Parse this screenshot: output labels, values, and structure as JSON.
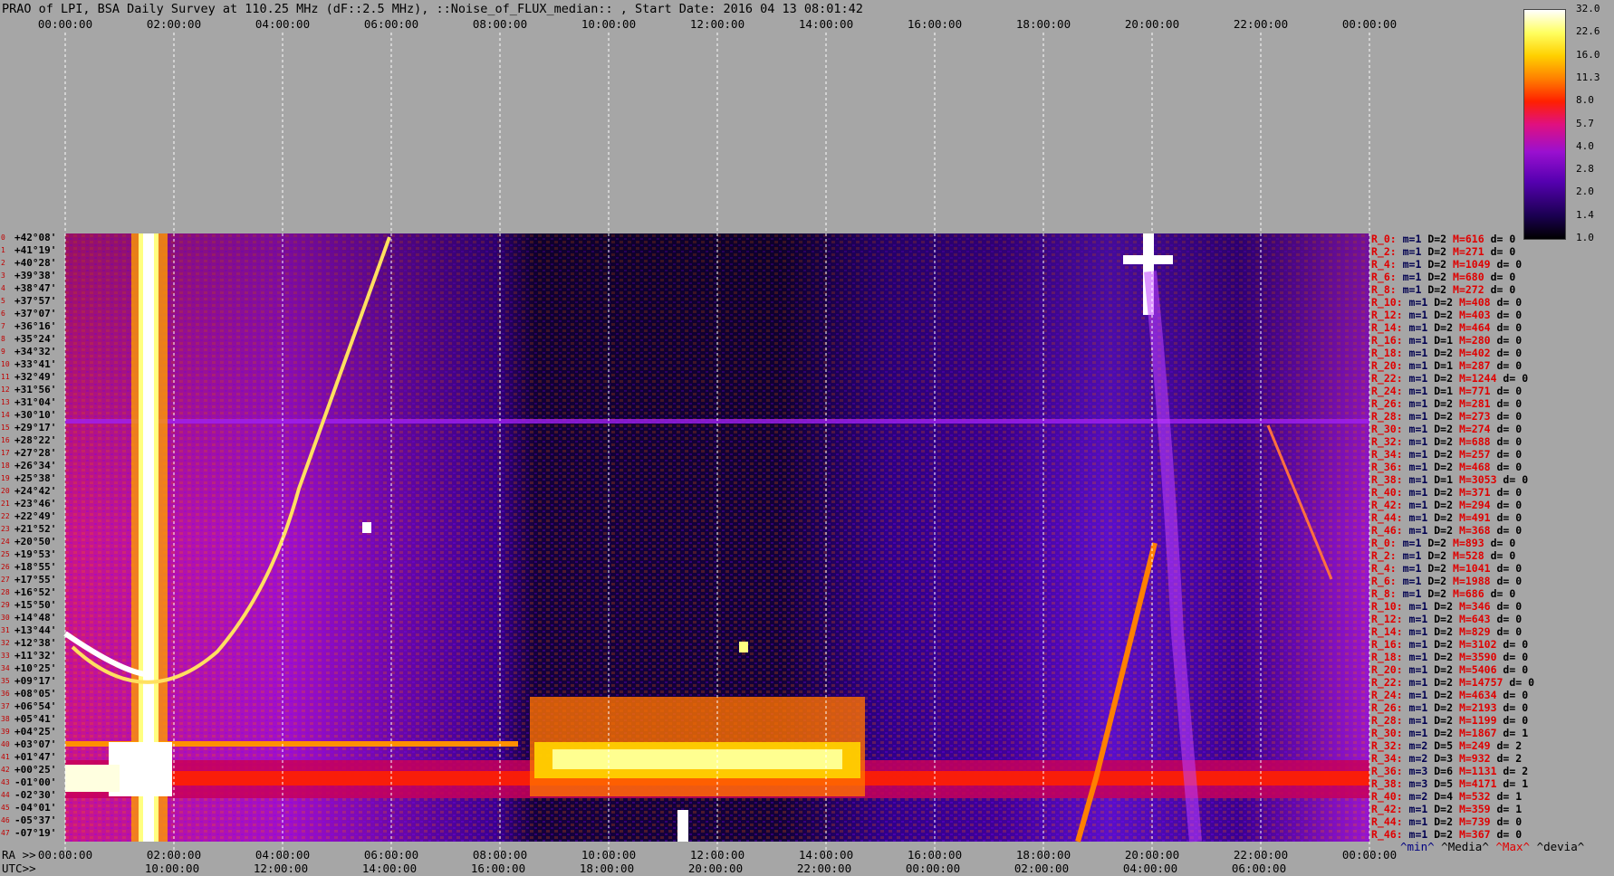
{
  "title": "PRAO of LPI, BSA Daily Survey at 110.25 MHz (dF::2.5 MHz), ::Noise_of_FLUX_median:: , Start Date: 2016 04 13 08:01:42",
  "top_axis_ticks": [
    "00:00:00",
    "02:00:00",
    "04:00:00",
    "06:00:00",
    "08:00:00",
    "10:00:00",
    "12:00:00",
    "14:00:00",
    "16:00:00",
    "18:00:00",
    "20:00:00",
    "22:00:00",
    "00:00:00"
  ],
  "ra_label": "RA >>",
  "utc_label": "UTC>>",
  "bottom_ra_ticks": [
    "00:00:00",
    "02:00:00",
    "04:00:00",
    "06:00:00",
    "08:00:00",
    "10:00:00",
    "12:00:00",
    "14:00:00",
    "16:00:00",
    "18:00:00",
    "20:00:00",
    "22:00:00",
    "00:00:00"
  ],
  "bottom_utc_ticks": [
    "10:00:00",
    "12:00:00",
    "14:00:00",
    "16:00:00",
    "18:00:00",
    "20:00:00",
    "22:00:00",
    "00:00:00",
    "02:00:00",
    "04:00:00",
    "06:00:00"
  ],
  "colorbar_ticks": [
    "32.0",
    "22.6",
    "16.0",
    "11.3",
    "8.0",
    "5.7",
    "4.0",
    "2.8",
    "2.0",
    "1.4",
    "1.0"
  ],
  "declinations": [
    "+42°08'",
    "+41°19'",
    "+40°28'",
    "+39°38'",
    "+38°47'",
    "+37°57'",
    "+37°07'",
    "+36°16'",
    "+35°24'",
    "+34°32'",
    "+33°41'",
    "+32°49'",
    "+31°56'",
    "+31°04'",
    "+30°10'",
    "+29°17'",
    "+28°22'",
    "+27°28'",
    "+26°34'",
    "+25°38'",
    "+24°42'",
    "+23°46'",
    "+22°49'",
    "+21°52'",
    "+20°50'",
    "+19°53'",
    "+18°55'",
    "+17°55'",
    "+16°52'",
    "+15°50'",
    "+14°48'",
    "+13°44'",
    "+12°38'",
    "+11°32'",
    "+10°25'",
    "+09°17'",
    "+08°05'",
    "+06°54'",
    "+05°41'",
    "+04°25'",
    "+03°07'",
    "+01°47'",
    "+00°25'",
    "-01°00'",
    "-02°30'",
    "-04°01'",
    "-05°37'",
    "-07°19'"
  ],
  "row_indices": [
    "0",
    "1",
    "2",
    "3",
    "4",
    "5",
    "6",
    "7",
    "8",
    "9",
    "10",
    "11",
    "12",
    "13",
    "14",
    "15",
    "16",
    "17",
    "18",
    "19",
    "20",
    "21",
    "22",
    "23",
    "24",
    "25",
    "26",
    "27",
    "28",
    "29",
    "30",
    "31",
    "32",
    "33",
    "34",
    "35",
    "36",
    "37",
    "38",
    "39",
    "40",
    "41",
    "42",
    "43",
    "44",
    "45",
    "46",
    "47"
  ],
  "right_rows": [
    {
      "r": "R_0:",
      "m": "m=1",
      "d": "D=2",
      "M": "M=616",
      "dv": "d= 0"
    },
    {
      "r": "R_2:",
      "m": "m=1",
      "d": "D=2",
      "M": "M=271",
      "dv": "d= 0"
    },
    {
      "r": "R_4:",
      "m": "m=1",
      "d": "D=2",
      "M": "M=1049",
      "dv": "d= 0"
    },
    {
      "r": "R_6:",
      "m": "m=1",
      "d": "D=2",
      "M": "M=680",
      "dv": "d= 0"
    },
    {
      "r": "R_8:",
      "m": "m=1",
      "d": "D=2",
      "M": "M=272",
      "dv": "d= 0"
    },
    {
      "r": "R_10:",
      "m": "m=1",
      "d": "D=2",
      "M": "M=408",
      "dv": "d= 0"
    },
    {
      "r": "R_12:",
      "m": "m=1",
      "d": "D=2",
      "M": "M=403",
      "dv": "d= 0"
    },
    {
      "r": "R_14:",
      "m": "m=1",
      "d": "D=2",
      "M": "M=464",
      "dv": "d= 0"
    },
    {
      "r": "R_16:",
      "m": "m=1",
      "d": "D=1",
      "M": "M=280",
      "dv": "d= 0"
    },
    {
      "r": "R_18:",
      "m": "m=1",
      "d": "D=2",
      "M": "M=402",
      "dv": "d= 0"
    },
    {
      "r": "R_20:",
      "m": "m=1",
      "d": "D=1",
      "M": "M=287",
      "dv": "d= 0"
    },
    {
      "r": "R_22:",
      "m": "m=1",
      "d": "D=2",
      "M": "M=1244",
      "dv": "d= 0"
    },
    {
      "r": "R_24:",
      "m": "m=1",
      "d": "D=1",
      "M": "M=771",
      "dv": "d= 0"
    },
    {
      "r": "R_26:",
      "m": "m=1",
      "d": "D=2",
      "M": "M=281",
      "dv": "d= 0"
    },
    {
      "r": "R_28:",
      "m": "m=1",
      "d": "D=2",
      "M": "M=273",
      "dv": "d= 0"
    },
    {
      "r": "R_30:",
      "m": "m=1",
      "d": "D=2",
      "M": "M=274",
      "dv": "d= 0"
    },
    {
      "r": "R_32:",
      "m": "m=1",
      "d": "D=2",
      "M": "M=688",
      "dv": "d= 0"
    },
    {
      "r": "R_34:",
      "m": "m=1",
      "d": "D=2",
      "M": "M=257",
      "dv": "d= 0"
    },
    {
      "r": "R_36:",
      "m": "m=1",
      "d": "D=2",
      "M": "M=468",
      "dv": "d= 0"
    },
    {
      "r": "R_38:",
      "m": "m=1",
      "d": "D=1",
      "M": "M=3053",
      "dv": "d= 0"
    },
    {
      "r": "R_40:",
      "m": "m=1",
      "d": "D=2",
      "M": "M=371",
      "dv": "d= 0"
    },
    {
      "r": "R_42:",
      "m": "m=1",
      "d": "D=2",
      "M": "M=294",
      "dv": "d= 0"
    },
    {
      "r": "R_44:",
      "m": "m=1",
      "d": "D=2",
      "M": "M=491",
      "dv": "d= 0"
    },
    {
      "r": "R_46:",
      "m": "m=1",
      "d": "D=2",
      "M": "M=368",
      "dv": "d= 0"
    },
    {
      "r": "R_0:",
      "m": "m=1",
      "d": "D=2",
      "M": "M=893",
      "dv": "d= 0"
    },
    {
      "r": "R_2:",
      "m": "m=1",
      "d": "D=2",
      "M": "M=528",
      "dv": "d= 0"
    },
    {
      "r": "R_4:",
      "m": "m=1",
      "d": "D=2",
      "M": "M=1041",
      "dv": "d= 0"
    },
    {
      "r": "R_6:",
      "m": "m=1",
      "d": "D=2",
      "M": "M=1988",
      "dv": "d= 0"
    },
    {
      "r": "R_8:",
      "m": "m=1",
      "d": "D=2",
      "M": "M=686",
      "dv": "d= 0"
    },
    {
      "r": "R_10:",
      "m": "m=1",
      "d": "D=2",
      "M": "M=346",
      "dv": "d= 0"
    },
    {
      "r": "R_12:",
      "m": "m=1",
      "d": "D=2",
      "M": "M=643",
      "dv": "d= 0"
    },
    {
      "r": "R_14:",
      "m": "m=1",
      "d": "D=2",
      "M": "M=829",
      "dv": "d= 0"
    },
    {
      "r": "R_16:",
      "m": "m=1",
      "d": "D=2",
      "M": "M=3102",
      "dv": "d= 0"
    },
    {
      "r": "R_18:",
      "m": "m=1",
      "d": "D=2",
      "M": "M=3590",
      "dv": "d= 0"
    },
    {
      "r": "R_20:",
      "m": "m=1",
      "d": "D=2",
      "M": "M=5406",
      "dv": "d= 0"
    },
    {
      "r": "R_22:",
      "m": "m=1",
      "d": "D=2",
      "M": "M=14757",
      "dv": "d= 0"
    },
    {
      "r": "R_24:",
      "m": "m=1",
      "d": "D=2",
      "M": "M=4634",
      "dv": "d= 0"
    },
    {
      "r": "R_26:",
      "m": "m=1",
      "d": "D=2",
      "M": "M=2193",
      "dv": "d= 0"
    },
    {
      "r": "R_28:",
      "m": "m=1",
      "d": "D=2",
      "M": "M=1199",
      "dv": "d= 0"
    },
    {
      "r": "R_30:",
      "m": "m=1",
      "d": "D=2",
      "M": "M=1867",
      "dv": "d= 1"
    },
    {
      "r": "R_32:",
      "m": "m=2",
      "d": "D=5",
      "M": "M=249",
      "dv": "d= 2"
    },
    {
      "r": "R_34:",
      "m": "m=2",
      "d": "D=3",
      "M": "M=932",
      "dv": "d= 2"
    },
    {
      "r": "R_36:",
      "m": "m=3",
      "d": "D=6",
      "M": "M=1131",
      "dv": "d= 2"
    },
    {
      "r": "R_38:",
      "m": "m=3",
      "d": "D=5",
      "M": "M=4171",
      "dv": "d= 1"
    },
    {
      "r": "R_40:",
      "m": "m=2",
      "d": "D=4",
      "M": "M=532",
      "dv": "d= 1"
    },
    {
      "r": "R_42:",
      "m": "m=1",
      "d": "D=2",
      "M": "M=359",
      "dv": "d= 1"
    },
    {
      "r": "R_44:",
      "m": "m=1",
      "d": "D=2",
      "M": "M=739",
      "dv": "d= 0"
    },
    {
      "r": "R_46:",
      "m": "m=1",
      "d": "D=2",
      "M": "M=367",
      "dv": "d= 0"
    }
  ],
  "legend": {
    "min": "^min^",
    "media": "^Media^",
    "max": "^Max^",
    "devia": "^devia^"
  },
  "chart_data": {
    "type": "heatmap",
    "title": "PRAO of LPI, BSA Daily Survey at 110.25 MHz (dF::2.5 MHz), ::Noise_of_FLUX_median:: , Start Date: 2016 04 13 08:01:42",
    "x_axis": "RA (sidereal time) 00:00:00 - 24:00:00",
    "y_axis": "Declination, beams 0-47",
    "colorscale_range": [
      1.0,
      32.0
    ],
    "colorscale": "log"
  }
}
